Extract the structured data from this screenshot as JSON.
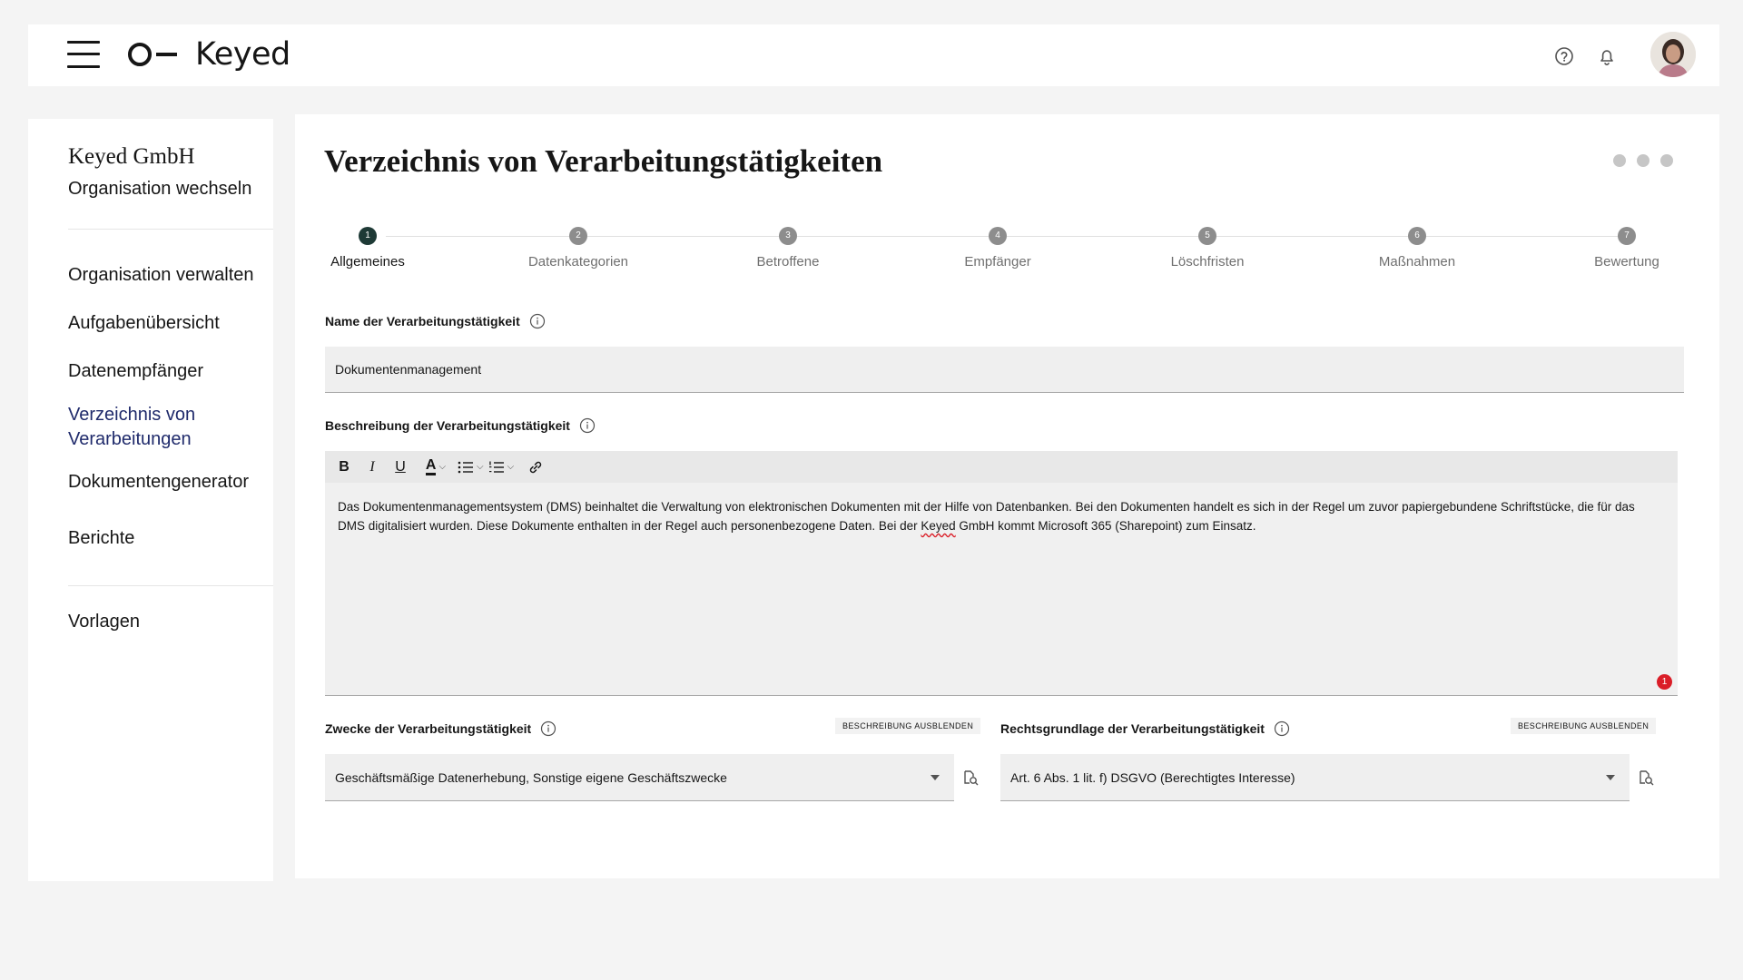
{
  "header": {
    "logo_text": "Keyed",
    "icons": [
      "menu-icon",
      "help-icon",
      "bell-icon",
      "avatar"
    ]
  },
  "sidebar": {
    "org_name": "Keyed GmbH",
    "org_switch": "Organisation wechseln",
    "items": [
      {
        "label": "Organisation verwalten"
      },
      {
        "label": "Aufgabenübersicht"
      },
      {
        "label": "Datenempfänger"
      },
      {
        "label": "Verzeichnis von Verarbeitungen"
      },
      {
        "label": "Dokumentengenerator"
      },
      {
        "label": "Berichte"
      },
      {
        "label": "Vorlagen"
      }
    ]
  },
  "main": {
    "title": "Verzeichnis von Verarbeitungstätigkeiten",
    "steps": [
      {
        "number": "1",
        "label": "Allgemeines"
      },
      {
        "number": "2",
        "label": "Datenkategorien"
      },
      {
        "number": "3",
        "label": "Betroffene"
      },
      {
        "number": "4",
        "label": "Empfänger"
      },
      {
        "number": "5",
        "label": "Löschfristen"
      },
      {
        "number": "6",
        "label": "Maßnahmen"
      },
      {
        "number": "7",
        "label": "Bewertung"
      }
    ],
    "name_label": "Name der Verarbeitungstätigkeit",
    "name_value": "Dokumentenmanagement",
    "description_label": "Beschreibung der Verarbeitungstätigkeit",
    "description_text_part1": "Das Dokumentenmanagementsystem (DMS) beinhaltet die Verwaltung von elektronischen Dokumenten mit der Hilfe von Datenbanken. Bei den Dokumenten handelt es sich in der Regel um zuvor papiergebundene Schriftstücke, die für das DMS digitalisiert wurden. Diese Dokumente enthalten in der Regel auch personenbezogene Daten. Bei der ",
    "description_text_spell": "Keyed",
    "description_text_part2": " GmbH kommt Microsoft 365 (Sharepoint) zum Einsatz.",
    "issue_count": "1",
    "purpose_label": "Zwecke der Verarbeitungstätigkeit",
    "purpose_hide": "BESCHREIBUNG AUSBLENDEN",
    "purpose_value": "Geschäftsmäßige Datenerhebung, Sonstige eigene Geschäftszwecke",
    "legal_label": "Rechtsgrundlage der Verarbeitungstätigkeit",
    "legal_hide": "BESCHREIBUNG AUSBLENDEN",
    "legal_value": "Art. 6 Abs. 1 lit. f) DSGVO (Berechtigtes Interesse)"
  },
  "colors": {
    "active_nav": "#1f2a6b",
    "active_step": "#1e3a36",
    "badge": "#da1e28"
  }
}
